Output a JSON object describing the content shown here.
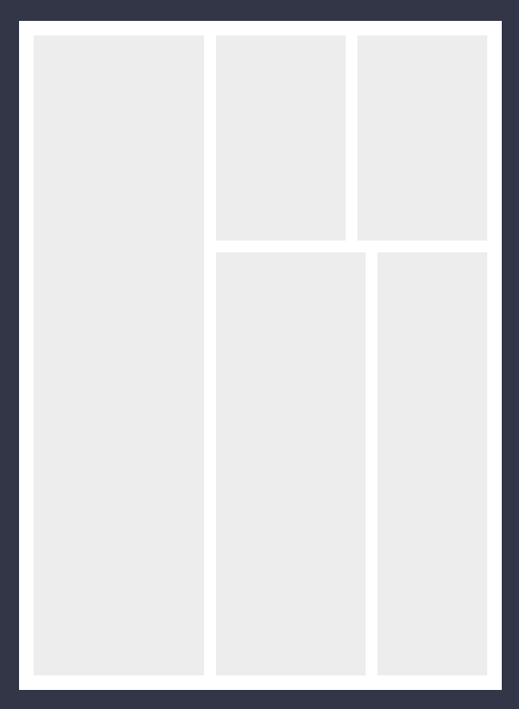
{
  "theme": {
    "background": "#323646",
    "page_background": "#ffffff",
    "panel_fill": "#ededed"
  },
  "layout_panels": [
    {
      "name": "left-column-panel",
      "content": ""
    },
    {
      "name": "top-middle-panel",
      "content": ""
    },
    {
      "name": "top-right-panel",
      "content": ""
    },
    {
      "name": "bottom-middle-panel",
      "content": ""
    },
    {
      "name": "bottom-right-panel",
      "content": ""
    }
  ]
}
